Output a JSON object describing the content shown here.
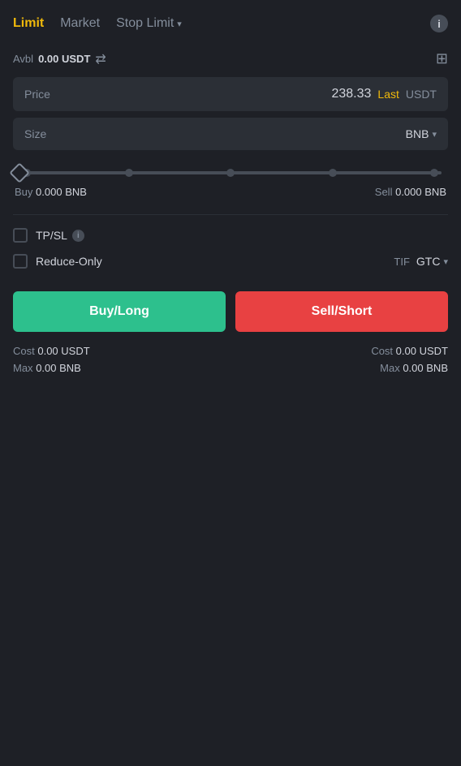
{
  "tabs": [
    {
      "id": "limit",
      "label": "Limit",
      "active": true
    },
    {
      "id": "market",
      "label": "Market",
      "active": false
    },
    {
      "id": "stop-limit",
      "label": "Stop Limit",
      "active": false
    }
  ],
  "info_icon_label": "i",
  "avbl": {
    "label": "Avbl",
    "value": "0.00",
    "currency": "USDT"
  },
  "price_field": {
    "label": "Price",
    "value": "238.33",
    "badge": "Last",
    "currency": "USDT"
  },
  "size_field": {
    "label": "Size",
    "currency": "BNB",
    "chevron": "▾"
  },
  "slider": {
    "positions": [
      "0%",
      "25%",
      "50%",
      "75%",
      "100%"
    ],
    "current": 0
  },
  "buy_amount": {
    "label": "Buy",
    "value": "0.000",
    "currency": "BNB"
  },
  "sell_amount": {
    "label": "Sell",
    "value": "0.000",
    "currency": "BNB"
  },
  "tpsl": {
    "label": "TP/SL"
  },
  "reduce_only": {
    "label": "Reduce-Only"
  },
  "tif": {
    "label": "TIF",
    "value": "GTC",
    "chevron": "▾"
  },
  "buy_button": {
    "label": "Buy/Long"
  },
  "sell_button": {
    "label": "Sell/Short"
  },
  "buy_cost": {
    "label": "Cost",
    "value": "0.00",
    "currency": "USDT"
  },
  "buy_max": {
    "label": "Max",
    "value": "0.00",
    "currency": "BNB"
  },
  "sell_cost": {
    "label": "Cost",
    "value": "0.00",
    "currency": "USDT"
  },
  "sell_max": {
    "label": "Max",
    "value": "0.00",
    "currency": "BNB"
  },
  "colors": {
    "active_tab": "#f0b90b",
    "buy_button": "#2dc08d",
    "sell_button": "#e84142",
    "last_badge": "#f0b90b"
  }
}
